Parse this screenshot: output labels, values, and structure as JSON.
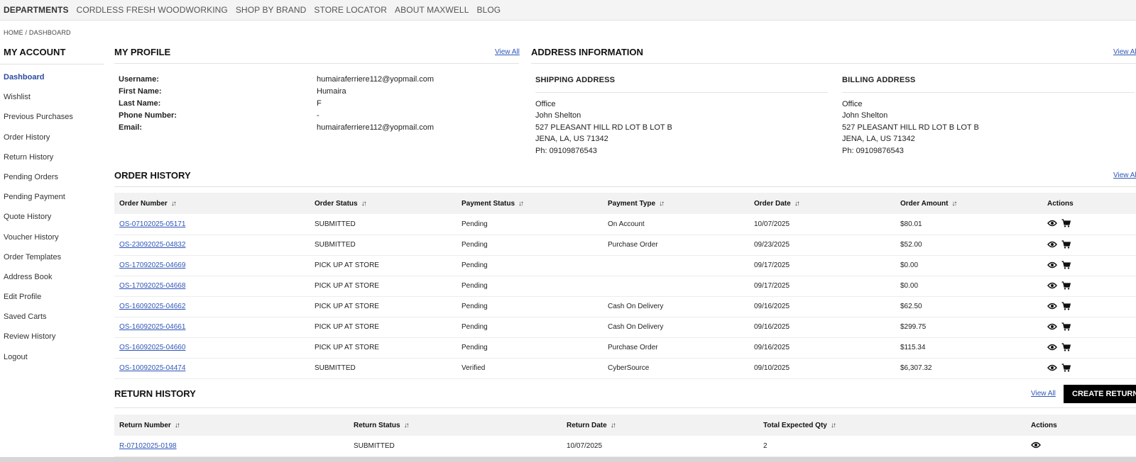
{
  "topnav": {
    "items": [
      "DEPARTMENTS",
      "CORDLESS FRESH WOODWORKING",
      "SHOP BY BRAND",
      "STORE LOCATOR",
      "ABOUT MAXWELL",
      "BLOG"
    ]
  },
  "breadcrumb": "HOME / DASHBOARD",
  "sidebar": {
    "title": "MY ACCOUNT",
    "items": [
      "Dashboard",
      "Wishlist",
      "Previous Purchases",
      "Order History",
      "Return History",
      "Pending Orders",
      "Pending Payment",
      "Quote History",
      "Voucher History",
      "Order Templates",
      "Address Book",
      "Edit Profile",
      "Saved Carts",
      "Review History",
      "Logout"
    ],
    "active": "Dashboard"
  },
  "profile": {
    "title": "MY PROFILE",
    "view_all": "View All",
    "fields": [
      {
        "label": "Username:",
        "value": "humairaferriere112@yopmail.com"
      },
      {
        "label": "First Name:",
        "value": "Humaira"
      },
      {
        "label": "Last Name:",
        "value": "F"
      },
      {
        "label": "Phone Number:",
        "value": "-"
      },
      {
        "label": "Email:",
        "value": "humairaferriere112@yopmail.com"
      }
    ]
  },
  "address": {
    "title": "ADDRESS INFORMATION",
    "view_all": "View All",
    "shipping": {
      "title": "SHIPPING ADDRESS",
      "lines": [
        "Office",
        "John Shelton",
        "527 PLEASANT HILL RD LOT B LOT B",
        "JENA, LA, US 71342",
        "Ph: 09109876543"
      ]
    },
    "billing": {
      "title": "BILLING ADDRESS",
      "lines": [
        "Office",
        "John Shelton",
        "527 PLEASANT HILL RD LOT B LOT B",
        "JENA, LA, US 71342",
        "Ph: 09109876543"
      ]
    }
  },
  "orders": {
    "title": "ORDER HISTORY",
    "view_all": "View All",
    "columns": [
      "Order Number",
      "Order Status",
      "Payment Status",
      "Payment Type",
      "Order Date",
      "Order Amount",
      "Actions"
    ],
    "rows": [
      {
        "number": "OS-07102025-05171",
        "status": "SUBMITTED",
        "payment_status": "Pending",
        "payment_type": "On Account",
        "date": "10/07/2025",
        "amount": "$80.01"
      },
      {
        "number": "OS-23092025-04832",
        "status": "SUBMITTED",
        "payment_status": "Pending",
        "payment_type": "Purchase Order",
        "date": "09/23/2025",
        "amount": "$52.00"
      },
      {
        "number": "OS-17092025-04669",
        "status": "PICK UP AT STORE",
        "payment_status": "Pending",
        "payment_type": "",
        "date": "09/17/2025",
        "amount": "$0.00"
      },
      {
        "number": "OS-17092025-04668",
        "status": "PICK UP AT STORE",
        "payment_status": "Pending",
        "payment_type": "",
        "date": "09/17/2025",
        "amount": "$0.00"
      },
      {
        "number": "OS-16092025-04662",
        "status": "PICK UP AT STORE",
        "payment_status": "Pending",
        "payment_type": "Cash On Delivery",
        "date": "09/16/2025",
        "amount": "$62.50"
      },
      {
        "number": "OS-16092025-04661",
        "status": "PICK UP AT STORE",
        "payment_status": "Pending",
        "payment_type": "Cash On Delivery",
        "date": "09/16/2025",
        "amount": "$299.75"
      },
      {
        "number": "OS-16092025-04660",
        "status": "PICK UP AT STORE",
        "payment_status": "Pending",
        "payment_type": "Purchase Order",
        "date": "09/16/2025",
        "amount": "$115.34"
      },
      {
        "number": "OS-10092025-04474",
        "status": "SUBMITTED",
        "payment_status": "Verified",
        "payment_type": "CyberSource",
        "date": "09/10/2025",
        "amount": "$6,307.32"
      }
    ]
  },
  "returns": {
    "title": "RETURN HISTORY",
    "view_all": "View All",
    "create_label": "CREATE RETURN",
    "columns": [
      "Return Number",
      "Return Status",
      "Return Date",
      "Total Expected Qty",
      "Actions"
    ],
    "rows": [
      {
        "number": "R-07102025-0198",
        "status": "SUBMITTED",
        "date": "10/07/2025",
        "qty": "2"
      }
    ]
  },
  "icons": {
    "sort": "sort-arrows-icon",
    "view": "eye-icon",
    "cart": "cart-icon"
  },
  "colors": {
    "link": "#2e55b8",
    "active_nav": "#2b4aa0",
    "button_bg": "#000000",
    "table_header_bg": "#f2f2f2"
  }
}
